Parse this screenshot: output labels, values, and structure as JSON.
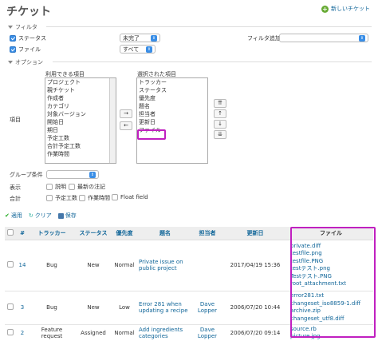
{
  "header": {
    "title": "チケット",
    "new_issue": "新しいチケット"
  },
  "filters": {
    "section": "フィルタ",
    "rows": [
      {
        "label": "ステータス",
        "checked": true,
        "value": "未完了"
      },
      {
        "label": "ファイル",
        "checked": true,
        "value": "すべて"
      }
    ],
    "add_label": "フィルタ追加",
    "add_value": ""
  },
  "options": {
    "section": "オプション",
    "columns_label": "項目",
    "available_label": "利用できる項目",
    "available": [
      "プロジェクト",
      "親チケット",
      "作成者",
      "カテゴリ",
      "対象バージョン",
      "開始日",
      "期日",
      "予定工数",
      "合計予定工数",
      "作業時間"
    ],
    "selected_label": "選択された項目",
    "selected": [
      "トラッカー",
      "ステータス",
      "優先度",
      "題名",
      "担当者",
      "更新日",
      "ファイル"
    ],
    "add_btn": "→",
    "remove_btn": "←",
    "move_top": "⇈",
    "move_up": "↑",
    "move_down": "↓",
    "move_bottom": "⇊",
    "group_label": "グループ条件",
    "group_value": "",
    "show_label": "表示",
    "show_options": [
      {
        "label": "説明",
        "checked": false
      },
      {
        "label": "最新の注記",
        "checked": false
      }
    ],
    "totals_label": "合計",
    "totals_options": [
      {
        "label": "予定工数",
        "checked": false
      },
      {
        "label": "作業時間",
        "checked": false
      },
      {
        "label": "Float field",
        "checked": false
      }
    ]
  },
  "actions": {
    "apply": "適用",
    "clear": "クリア",
    "save": "保存"
  },
  "table": {
    "headers": {
      "num": "#",
      "tracker": "トラッカー",
      "status": "ステータス",
      "priority": "優先度",
      "subject": "題名",
      "assignee": "担当者",
      "updated": "更新日",
      "files": "ファイル"
    },
    "rows": [
      {
        "id": "14",
        "tracker": "Bug",
        "status": "New",
        "priority": "Normal",
        "subject": "Private issue on public project",
        "assignee": "",
        "updated": "2017/04/19 15:36",
        "files": [
          "private.diff",
          "testfile.png",
          "testfile.PNG",
          "testテスト.png",
          "Testテスト.PNG",
          "root_attachment.txt"
        ]
      },
      {
        "id": "3",
        "tracker": "Bug",
        "status": "New",
        "priority": "Low",
        "subject": "Error 281 when updating a recipe",
        "assignee": "Dave Lopper",
        "updated": "2006/07/20 10:44",
        "files": [
          "error281.txt",
          "changeset_iso8859-1.diff",
          "archive.zip",
          "changeset_utf8.diff"
        ]
      },
      {
        "id": "2",
        "tracker": "Feature request",
        "status": "Assigned",
        "priority": "Normal",
        "subject": "Add ingredients categories",
        "assignee": "Dave Lopper",
        "updated": "2006/07/20 09:14",
        "files": [
          "source.rb",
          "picture.jpg"
        ]
      }
    ]
  },
  "colors": {
    "highlight": "#c020c0",
    "link": "#116699",
    "accent": "#3a8ee6"
  }
}
